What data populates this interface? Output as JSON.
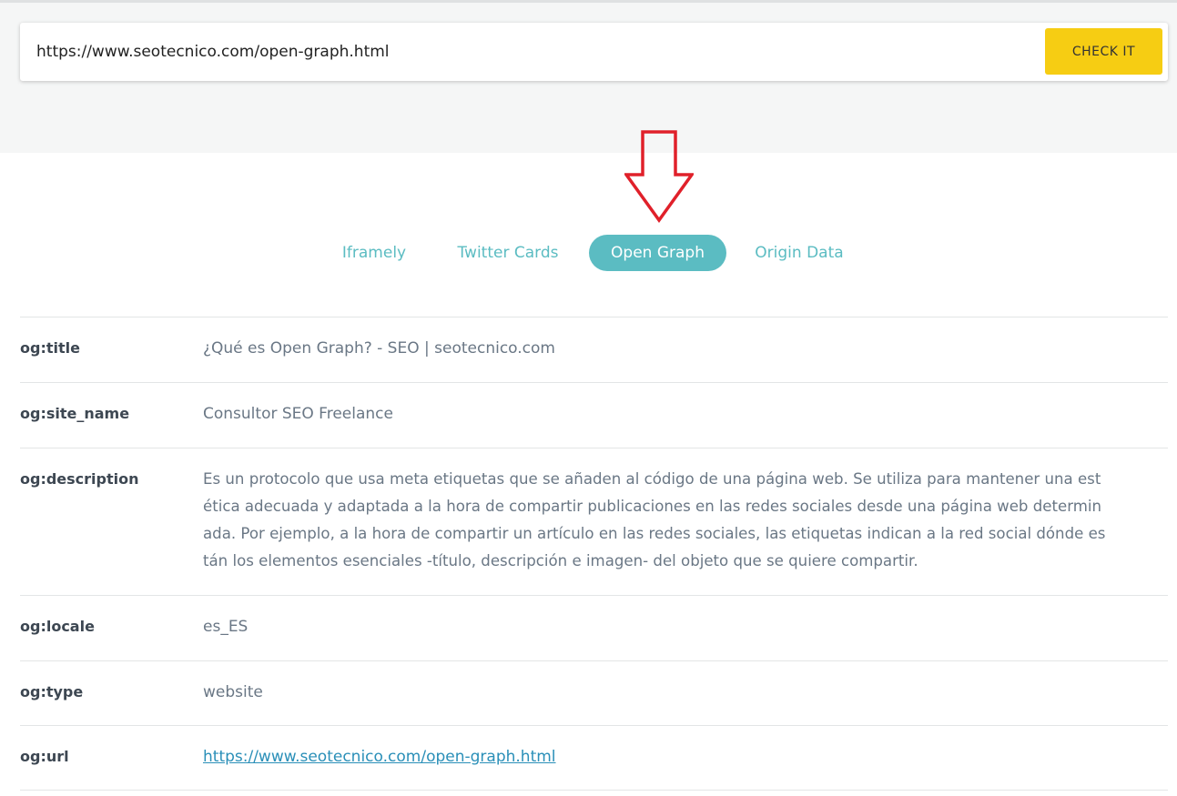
{
  "search": {
    "url_value": "https://www.seotecnico.com/open-graph.html",
    "button_label": "CHECK IT"
  },
  "tabs": [
    {
      "label": "Iframely",
      "active": false
    },
    {
      "label": "Twitter Cards",
      "active": false
    },
    {
      "label": "Open Graph",
      "active": true
    },
    {
      "label": "Origin Data",
      "active": false
    }
  ],
  "rows": [
    {
      "key": "og:title",
      "value": "¿Qué es Open Graph? - SEO | seotecnico.com"
    },
    {
      "key": "og:site_name",
      "value": "Consultor SEO Freelance"
    },
    {
      "key": "og:description",
      "lines": [
        "Es un protocolo que usa meta etiquetas que se añaden al código de una página web. Se utiliza para mantener una est",
        "ética adecuada y adaptada a la hora de compartir publicaciones en las redes sociales desde una página web determin",
        "ada. Por ejemplo, a la hora de compartir un artículo en las redes sociales, las etiquetas indican a la red social dónde es",
        "tán los elementos esenciales -título, descripción e imagen- del objeto que se quiere compartir."
      ]
    },
    {
      "key": "og:locale",
      "value": "es_ES"
    },
    {
      "key": "og:type",
      "value": "website"
    },
    {
      "key": "og:url",
      "value": "https://www.seotecnico.com/open-graph.html"
    }
  ],
  "colors": {
    "accent": "#5bbcc2",
    "button": "#f6cd13",
    "arrow": "#e0202a",
    "link": "#2a8fb8"
  },
  "icons": {
    "annotation": "down-arrow-icon"
  }
}
